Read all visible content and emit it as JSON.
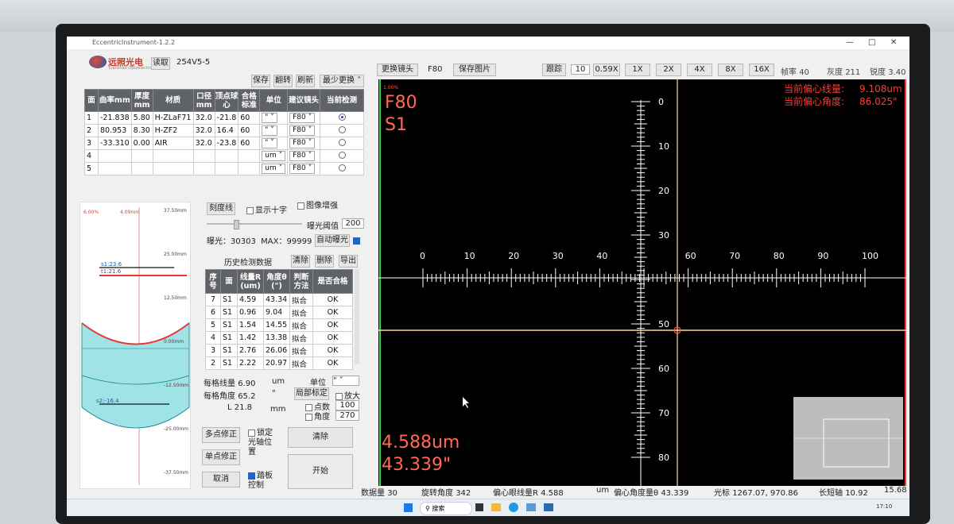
{
  "window": {
    "title": "EccentricInstrument-1.2.2"
  },
  "brand": {
    "name": "远照光电",
    "sub": "Yuanzhao Optoelectronics"
  },
  "header": {
    "read_label": "读取",
    "file_name": "254V5-5"
  },
  "top_buttons": {
    "save": "保存",
    "flip": "翻转",
    "refresh": "刷新",
    "min_change": "最少更换"
  },
  "lens_table": {
    "headers": [
      "面",
      "曲率mm",
      "厚度mm",
      "材质",
      "口径mm",
      "顶点球心",
      "合格标准",
      "单位",
      "建议镜头",
      "当前检测"
    ],
    "rows": [
      {
        "n": "1",
        "curv": "-21.838",
        "thick": "5.80",
        "mat": "H-ZLaF71",
        "dia": "32.0",
        "apex": "-21.8",
        "std": "60",
        "unit": "\"",
        "lens": "F80",
        "cur": true
      },
      {
        "n": "2",
        "curv": "80.953",
        "thick": "8.30",
        "mat": "H-ZF2",
        "dia": "32.0",
        "apex": "16.4",
        "std": "60",
        "unit": "\"",
        "lens": "F80",
        "cur": false
      },
      {
        "n": "3",
        "curv": "-33.310",
        "thick": "0.00",
        "mat": "AIR",
        "dia": "32.0",
        "apex": "-23.8",
        "std": "60",
        "unit": "\"",
        "lens": "F80",
        "cur": false
      },
      {
        "n": "4",
        "curv": "",
        "thick": "",
        "mat": "",
        "dia": "",
        "apex": "",
        "std": "",
        "unit": "um",
        "lens": "F80",
        "cur": false
      },
      {
        "n": "5",
        "curv": "",
        "thick": "",
        "mat": "",
        "dia": "",
        "apex": "",
        "std": "",
        "unit": "um",
        "lens": "F80",
        "cur": false
      }
    ]
  },
  "profile": {
    "pct_left": "6.00%",
    "pct_mid": "4.09mm",
    "scale": [
      "37.50mm",
      "25.00mm",
      "12.50mm",
      "0.00mm",
      "-12.50mm",
      "-25.00mm",
      "-37.50mm"
    ],
    "s1_label": "s1:23.6",
    "t1_label": "t1:21.6",
    "s2_label": "s2:-16.4",
    "colors": {
      "fill": "#9fe3e6",
      "curve": "#e53935"
    }
  },
  "controls": {
    "reticle": "刻度线",
    "show_cross": "显示十字",
    "enhance": "图像增强",
    "exposure_threshold_label": "曝光阈值",
    "exposure_threshold": "200",
    "exposure_label": "曝光：",
    "exposure": "30303",
    "max_label": "MAX：",
    "max": "99999",
    "auto_exposure": "自动曝光"
  },
  "history": {
    "title": "历史检测数据",
    "clear": "清除",
    "delete": "删除",
    "export": "导出",
    "headers": [
      "序号",
      "面",
      "线量R (um)",
      "角度θ (\")",
      "判断方法",
      "是否合格"
    ],
    "rows": [
      {
        "i": "7",
        "f": "S1",
        "r": "4.59",
        "a": "43.34",
        "m": "拟合",
        "ok": "OK"
      },
      {
        "i": "6",
        "f": "S1",
        "r": "0.96",
        "a": "9.04",
        "m": "拟合",
        "ok": "OK"
      },
      {
        "i": "5",
        "f": "S1",
        "r": "1.54",
        "a": "14.55",
        "m": "拟合",
        "ok": "OK"
      },
      {
        "i": "4",
        "f": "S1",
        "r": "1.42",
        "a": "13.38",
        "m": "拟合",
        "ok": "OK"
      },
      {
        "i": "3",
        "f": "S1",
        "r": "2.76",
        "a": "26.06",
        "m": "拟合",
        "ok": "OK"
      },
      {
        "i": "2",
        "f": "S1",
        "r": "2.22",
        "a": "20.97",
        "m": "拟合",
        "ok": "OK"
      }
    ]
  },
  "params": {
    "per_line_label": "每格线量",
    "per_line": "6.90",
    "per_line_unit": "um",
    "unit_label": "单位",
    "unit": "\"",
    "per_angle_label": "每格角度",
    "per_angle": "65.2",
    "per_angle_unit": "\"",
    "local_calib": "局部标定",
    "zoom": "放大",
    "L_label": "L",
    "L": "21.8",
    "L_unit": "mm",
    "points_label": "点数",
    "points": "100",
    "angle_label": "角度",
    "angle": "270"
  },
  "bottom_buttons": {
    "multi_fix": "多点修正",
    "single_fix": "单点修正",
    "cancel": "取消",
    "lock_axis": "锁定光轴位置",
    "pedal": "踏板控制",
    "clear": "清除",
    "start": "开始"
  },
  "right_toolbar": {
    "change_lens": "更换镜头",
    "lens": "F80",
    "save_image": "保存图片",
    "track": "跟踪",
    "track_val": "10",
    "mag_main": "0.59X",
    "mags": [
      "1X",
      "2X",
      "4X",
      "8X",
      "16X"
    ],
    "fps_label": "帧率",
    "fps": "40",
    "gray_label": "灰度",
    "gray": "211",
    "sharp_label": "锐度",
    "sharp": "3.40"
  },
  "viewer": {
    "small_pct": "1.00%",
    "lens": "F80",
    "surface": "S1",
    "ecc_line_label": "当前偏心线量:",
    "ecc_line": "9.108um",
    "ecc_angle_label": "当前偏心角度:",
    "ecc_angle": "86.025\"",
    "big_line": "4.588um",
    "big_angle": "43.339\"",
    "h_ticks": [
      "0",
      "10",
      "20",
      "30",
      "40",
      "60",
      "70",
      "80",
      "90",
      "100"
    ],
    "v_ticks": [
      "0",
      "10",
      "20",
      "30",
      "50",
      "60",
      "70",
      "80"
    ]
  },
  "status": {
    "count_label": "数据量",
    "count": "30",
    "rot_label": "旋转角度",
    "rot": "342",
    "ecc_r_label": "偏心眼线量R",
    "ecc_r": "4.588",
    "ecc_r_unit": "um",
    "ecc_a_label": "偏心角度量θ",
    "ecc_a": "43.339",
    "cursor_label": "光标",
    "cursor": "1267.07, 970.86",
    "long_axis_label": "长短轴",
    "long_axis": "10.92",
    "last": "15.68"
  },
  "taskbar": {
    "search": "搜索",
    "time": "17:10"
  }
}
